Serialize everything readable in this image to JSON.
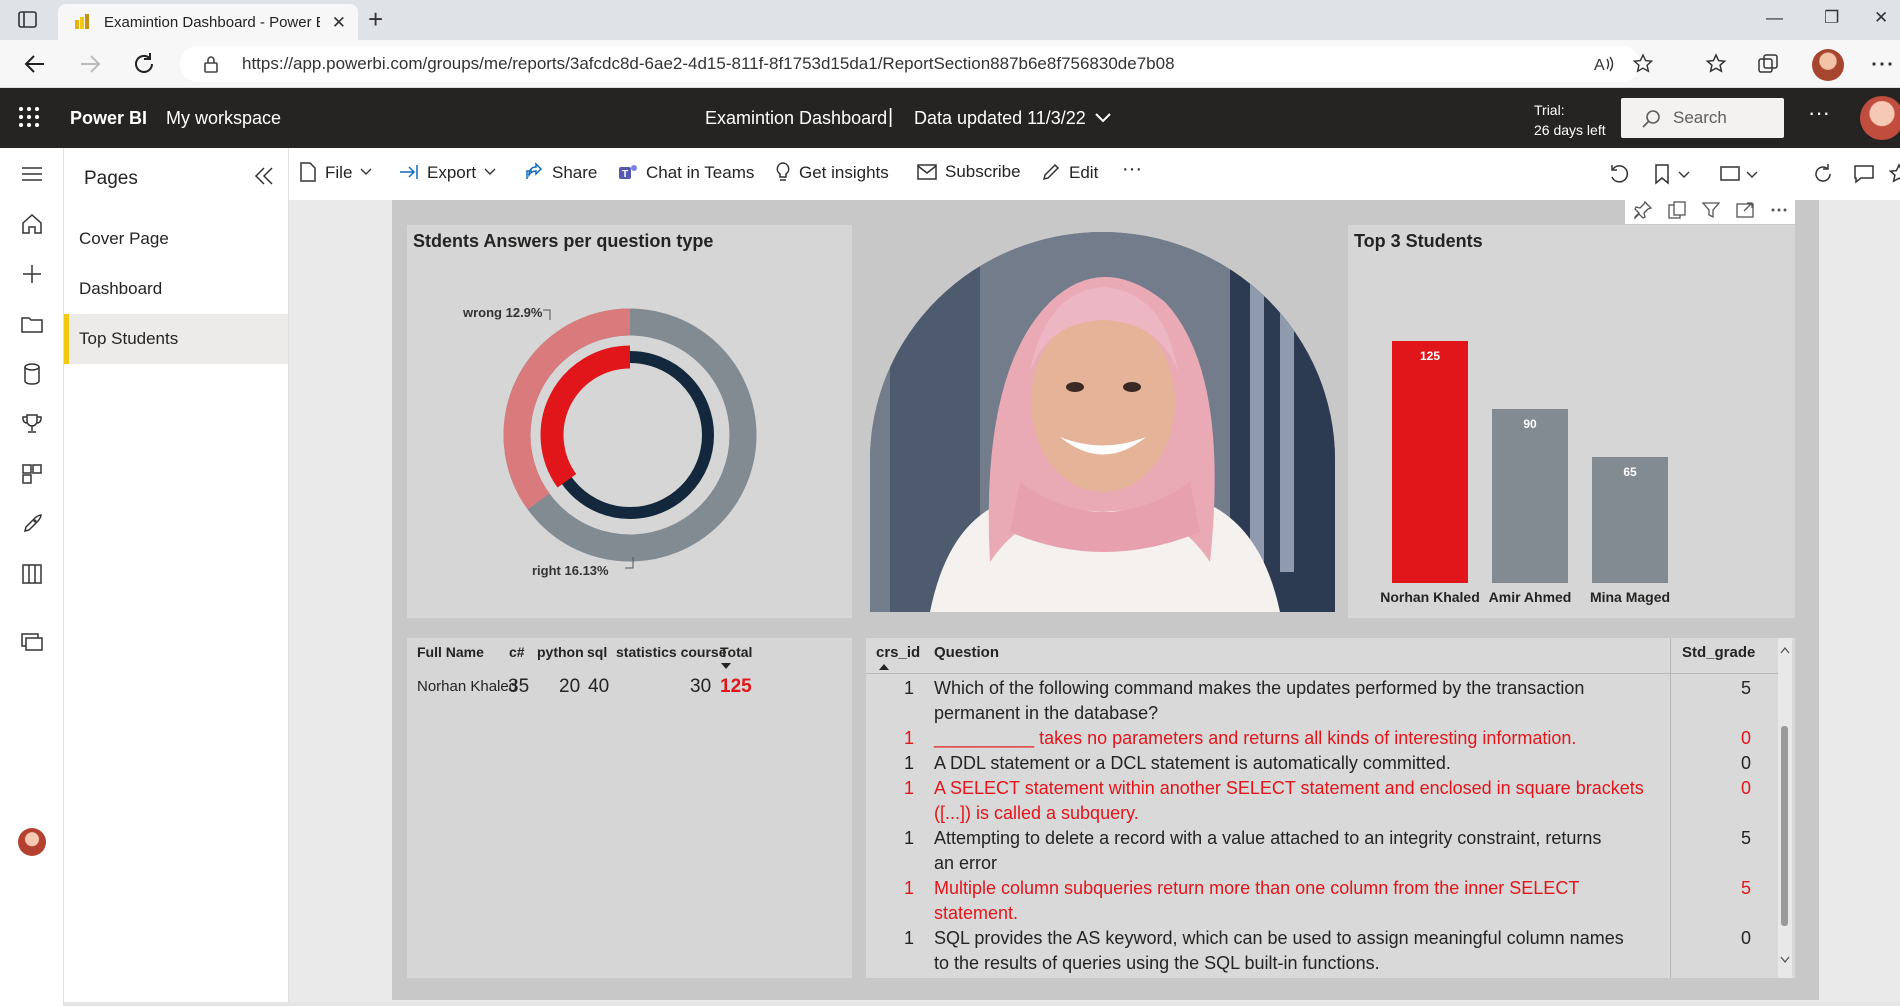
{
  "browser": {
    "tab_title": "Examintion Dashboard - Power BI",
    "url": "https://app.powerbi.com/groups/me/reports/3afcdc8d-6ae2-4d15-811f-8f1753d15da1/ReportSection887b6e8f756830de7b08"
  },
  "header": {
    "brand": "Power BI",
    "workspace": "My workspace",
    "report_title": "Examintion Dashboard",
    "separator": "|",
    "data_updated": "Data updated 11/3/22",
    "trial_line1": "Trial:",
    "trial_line2": "26 days left",
    "search_label": "Search",
    "more": "···"
  },
  "pages": {
    "title": "Pages",
    "items": [
      {
        "label": "Cover Page"
      },
      {
        "label": "Dashboard"
      },
      {
        "label": "Top Students"
      }
    ],
    "selected": "Top Students"
  },
  "actions": {
    "file": "File",
    "export": "Export",
    "share": "Share",
    "chat": "Chat in Teams",
    "insights": "Get insights",
    "subscribe": "Subscribe",
    "edit": "Edit",
    "more": "···"
  },
  "donut": {
    "title": "Stdents Answers per question type",
    "wrong_label": "wrong 12.9%",
    "right_label": "right 16.13%",
    "colors": {
      "outer_grey": "#828a92",
      "outer_pink": "#d97b7d",
      "inner_red": "#e1161b",
      "inner_navy": "#13283d"
    }
  },
  "chart_data": {
    "type": "bar",
    "title": "Top 3 Students",
    "categories": [
      "Norhan Khaled",
      "Amir Ahmed",
      "Mina Maged"
    ],
    "values": [
      125,
      90,
      65
    ],
    "colors": [
      "#e1161b",
      "#828a92",
      "#828a92"
    ],
    "ylim": [
      0,
      125
    ]
  },
  "grade_table": {
    "headers": [
      "Full Name",
      "c#",
      "python",
      "sql",
      "statistics course",
      "Total"
    ],
    "row": {
      "name": "Norhan Khaled",
      "csharp": "35",
      "python": "20",
      "sql": "40",
      "stats": "30",
      "total": "125"
    }
  },
  "question_table": {
    "headers": {
      "id": "crs_id",
      "question": "Question",
      "grade": "Std_grade"
    },
    "rows": [
      {
        "id": "1",
        "line1": "Which of the following command makes the updates performed by the transaction",
        "line2": "permanent in the database?",
        "grade": "5",
        "red": false
      },
      {
        "id": "1",
        "line1": "__________ takes no parameters and returns all kinds of interesting information.",
        "line2": "",
        "grade": "0",
        "red": true
      },
      {
        "id": "1",
        "line1": "A DDL statement or a DCL statement is automatically committed.",
        "line2": "",
        "grade": "0",
        "red": false
      },
      {
        "id": "1",
        "line1": "A SELECT statement within another SELECT statement and enclosed in square brackets",
        "line2": "([...]) is called a subquery.",
        "grade": "0",
        "red": true
      },
      {
        "id": "1",
        "line1": "Attempting to delete a record with a value attached to an integrity constraint, returns",
        "line2": "an error",
        "grade": "5",
        "red": false
      },
      {
        "id": "1",
        "line1": "Multiple column subqueries return more than one column from the inner SELECT",
        "line2": "statement.",
        "grade": "5",
        "red": true
      },
      {
        "id": "1",
        "line1": "SQL provides the AS keyword, which can be used to assign meaningful column names",
        "line2": "to the results of queries using the SQL built-in functions.",
        "grade": "0",
        "red": false
      }
    ]
  }
}
